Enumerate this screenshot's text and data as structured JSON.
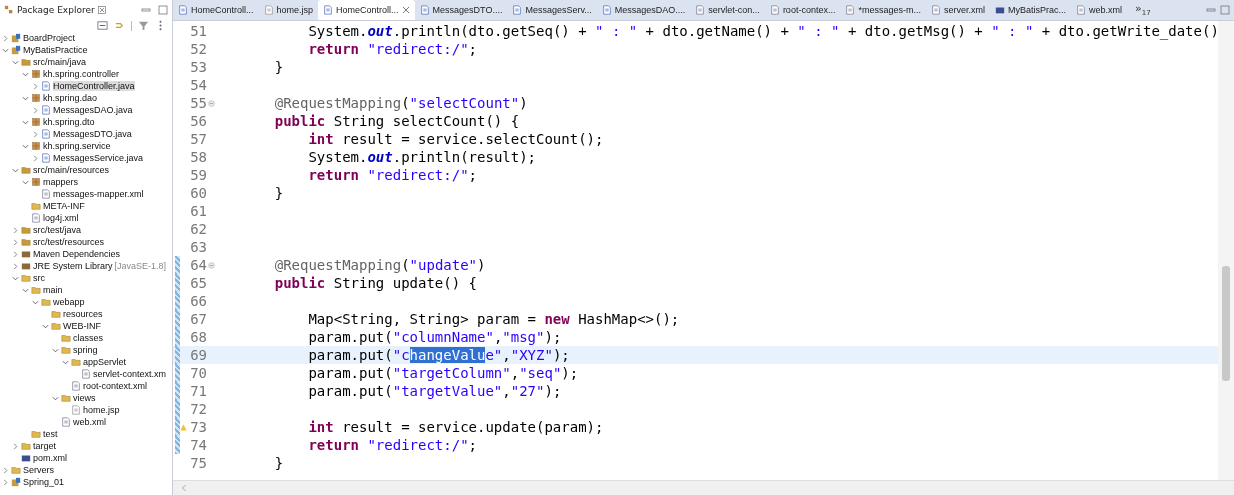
{
  "explorer": {
    "title": "Package Explorer",
    "tree": [
      {
        "label": "BoardProject",
        "kind": "project",
        "expanded": false
      },
      {
        "label": "MyBatisPractice",
        "kind": "project",
        "expanded": true,
        "children": [
          {
            "label": "src/main/java",
            "kind": "srcfolder",
            "expanded": true,
            "children": [
              {
                "label": "kh.spring.controller",
                "kind": "package",
                "expanded": true,
                "children": [
                  {
                    "label": "HomeController.java",
                    "kind": "java",
                    "expanded": false,
                    "selected": true
                  }
                ]
              },
              {
                "label": "kh.spring.dao",
                "kind": "package",
                "expanded": true,
                "children": [
                  {
                    "label": "MessagesDAO.java",
                    "kind": "java",
                    "expanded": false,
                    "selected": false
                  }
                ]
              },
              {
                "label": "kh.spring.dto",
                "kind": "package",
                "expanded": true,
                "children": [
                  {
                    "label": "MessagesDTO.java",
                    "kind": "java",
                    "expanded": false,
                    "selected": false
                  }
                ]
              },
              {
                "label": "kh.spring.service",
                "kind": "package",
                "expanded": true,
                "children": [
                  {
                    "label": "MessagesService.java",
                    "kind": "java",
                    "expanded": false,
                    "selected": false
                  }
                ]
              }
            ]
          },
          {
            "label": "src/main/resources",
            "kind": "srcfolder",
            "expanded": true,
            "children": [
              {
                "label": "mappers",
                "kind": "package",
                "expanded": true,
                "children": [
                  {
                    "label": "messages-mapper.xml",
                    "kind": "xml"
                  }
                ]
              },
              {
                "label": "META-INF",
                "kind": "folder"
              },
              {
                "label": "log4j.xml",
                "kind": "xml"
              }
            ]
          },
          {
            "label": "src/test/java",
            "kind": "srcfolder",
            "expanded": false
          },
          {
            "label": "src/test/resources",
            "kind": "srcfolder",
            "expanded": false
          },
          {
            "label": "Maven Dependencies",
            "kind": "library",
            "expanded": false
          },
          {
            "label": "JRE System Library",
            "suffix": "[JavaSE-1.8]",
            "kind": "library",
            "expanded": false
          },
          {
            "label": "src",
            "kind": "folder",
            "expanded": true,
            "children": [
              {
                "label": "main",
                "kind": "folder",
                "expanded": true,
                "children": [
                  {
                    "label": "webapp",
                    "kind": "folder",
                    "expanded": true,
                    "children": [
                      {
                        "label": "resources",
                        "kind": "folder"
                      },
                      {
                        "label": "WEB-INF",
                        "kind": "folder",
                        "expanded": true,
                        "children": [
                          {
                            "label": "classes",
                            "kind": "folder"
                          },
                          {
                            "label": "spring",
                            "kind": "folder",
                            "expanded": true,
                            "children": [
                              {
                                "label": "appServlet",
                                "kind": "folder",
                                "expanded": true,
                                "children": [
                                  {
                                    "label": "servlet-context.xm",
                                    "kind": "xml"
                                  }
                                ]
                              },
                              {
                                "label": "root-context.xml",
                                "kind": "xml"
                              }
                            ]
                          },
                          {
                            "label": "views",
                            "kind": "folder",
                            "expanded": true,
                            "children": [
                              {
                                "label": "home.jsp",
                                "kind": "jsp"
                              }
                            ]
                          },
                          {
                            "label": "web.xml",
                            "kind": "xml"
                          }
                        ]
                      }
                    ]
                  }
                ]
              },
              {
                "label": "test",
                "kind": "folder"
              }
            ]
          },
          {
            "label": "target",
            "kind": "folder",
            "expanded": false
          },
          {
            "label": "pom.xml",
            "kind": "maven"
          }
        ]
      },
      {
        "label": "Servers",
        "kind": "folder",
        "expanded": false
      },
      {
        "label": "Spring_01",
        "kind": "project",
        "expanded": false
      }
    ]
  },
  "tabs": [
    {
      "label": "HomeControll...",
      "kind": "java",
      "selected": false
    },
    {
      "label": "home.jsp",
      "kind": "jsp",
      "selected": false
    },
    {
      "label": "HomeControll...",
      "kind": "java",
      "selected": true
    },
    {
      "label": "MessagesDTO....",
      "kind": "java",
      "selected": false
    },
    {
      "label": "MessagesServ...",
      "kind": "java",
      "selected": false
    },
    {
      "label": "MessagesDAO....",
      "kind": "java",
      "selected": false
    },
    {
      "label": "servlet-con...",
      "kind": "xml",
      "selected": false
    },
    {
      "label": "root-contex...",
      "kind": "xml",
      "selected": false
    },
    {
      "label": "*messages-m...",
      "kind": "xml",
      "selected": false
    },
    {
      "label": "server.xml",
      "kind": "xml",
      "selected": false
    },
    {
      "label": "MyBatisPrac...",
      "kind": "maven",
      "selected": false
    },
    {
      "label": "web.xml",
      "kind": "xml",
      "selected": false
    }
  ],
  "overflow_tabs": {
    "symbol": "»",
    "count": "17"
  },
  "editor": {
    "lines": [
      {
        "number": "51",
        "current": false,
        "segments": [
          {
            "kind": "code",
            "text": "        System."
          },
          {
            "kind": "field",
            "text": "out"
          },
          {
            "kind": "code",
            "text": ".println(dto.getSeq() + "
          },
          {
            "kind": "string",
            "text": "\" : \""
          },
          {
            "kind": "code",
            "text": " + dto.getName() + "
          },
          {
            "kind": "string",
            "text": "\" : \""
          },
          {
            "kind": "code",
            "text": " + dto.getMsg() + "
          },
          {
            "kind": "string",
            "text": "\" : \""
          },
          {
            "kind": "code",
            "text": " + dto.getWrite_date()"
          }
        ]
      },
      {
        "number": "52",
        "current": false,
        "segments": [
          {
            "kind": "keyword",
            "text": "        return "
          },
          {
            "kind": "string",
            "text": "\"redirect:/\""
          },
          {
            "kind": "code",
            "text": ";"
          }
        ]
      },
      {
        "number": "53",
        "current": false,
        "segments": [
          {
            "kind": "code",
            "text": "    }"
          }
        ]
      },
      {
        "number": "54",
        "current": false
      },
      {
        "number": "55",
        "current": false,
        "fold": true,
        "segments": [
          {
            "kind": "annotation",
            "text": "    @RequestMapping"
          },
          {
            "kind": "code",
            "text": "("
          },
          {
            "kind": "string",
            "text": "\"selectCount\""
          },
          {
            "kind": "code",
            "text": ")"
          }
        ]
      },
      {
        "number": "56",
        "current": false,
        "segments": [
          {
            "kind": "keyword",
            "text": "    public "
          },
          {
            "kind": "code",
            "text": "String selectCount() {"
          }
        ]
      },
      {
        "number": "57",
        "current": false,
        "segments": [
          {
            "kind": "keyword",
            "text": "        int "
          },
          {
            "kind": "code",
            "text": "result = service.selectCount();"
          }
        ]
      },
      {
        "number": "58",
        "current": false,
        "segments": [
          {
            "kind": "code",
            "text": "        System."
          },
          {
            "kind": "field",
            "text": "out"
          },
          {
            "kind": "code",
            "text": ".println(result);"
          }
        ]
      },
      {
        "number": "59",
        "current": false,
        "segments": [
          {
            "kind": "keyword",
            "text": "        return "
          },
          {
            "kind": "string",
            "text": "\"redirect:/\""
          },
          {
            "kind": "code",
            "text": ";"
          }
        ]
      },
      {
        "number": "60",
        "current": false,
        "segments": [
          {
            "kind": "code",
            "text": "    }"
          }
        ]
      },
      {
        "number": "61",
        "current": false
      },
      {
        "number": "62",
        "current": false
      },
      {
        "number": "63",
        "current": false
      },
      {
        "number": "64",
        "current": false,
        "fold": true,
        "changed": true,
        "segments": [
          {
            "kind": "annotation",
            "text": "    @RequestMapping"
          },
          {
            "kind": "code",
            "text": "("
          },
          {
            "kind": "string",
            "text": "\"update\""
          },
          {
            "kind": "code",
            "text": ")"
          }
        ]
      },
      {
        "number": "65",
        "current": false,
        "changed": true,
        "segments": [
          {
            "kind": "keyword",
            "text": "    public "
          },
          {
            "kind": "code",
            "text": "String update() {"
          }
        ]
      },
      {
        "number": "66",
        "current": false,
        "changed": true
      },
      {
        "number": "67",
        "current": false,
        "changed": true,
        "segments": [
          {
            "kind": "code",
            "text": "        Map<String, String> param = "
          },
          {
            "kind": "keyword",
            "text": "new "
          },
          {
            "kind": "code",
            "text": "HashMap<>();"
          }
        ]
      },
      {
        "number": "68",
        "current": false,
        "changed": true,
        "segments": [
          {
            "kind": "code",
            "text": "        param.put("
          },
          {
            "kind": "string",
            "text": "\"columnName\""
          },
          {
            "kind": "code",
            "text": ","
          },
          {
            "kind": "string",
            "text": "\"msg\""
          },
          {
            "kind": "code",
            "text": ");"
          }
        ]
      },
      {
        "number": "69",
        "current": true,
        "changed": true,
        "segments": [
          {
            "kind": "code",
            "text": "        param.put("
          },
          {
            "kind": "string",
            "text": "\"c"
          },
          {
            "kind": "selection",
            "text": "hangeValu"
          },
          {
            "kind": "string",
            "text": "e\""
          },
          {
            "kind": "code",
            "text": ","
          },
          {
            "kind": "string",
            "text": "\"XYZ\""
          },
          {
            "kind": "code",
            "text": ");"
          }
        ]
      },
      {
        "number": "70",
        "current": false,
        "changed": true,
        "segments": [
          {
            "kind": "code",
            "text": "        param.put("
          },
          {
            "kind": "string",
            "text": "\"targetColumn\""
          },
          {
            "kind": "code",
            "text": ","
          },
          {
            "kind": "string",
            "text": "\"seq\""
          },
          {
            "kind": "code",
            "text": ");"
          }
        ]
      },
      {
        "number": "71",
        "current": false,
        "changed": true,
        "segments": [
          {
            "kind": "code",
            "text": "        param.put("
          },
          {
            "kind": "string",
            "text": "\"targetValue\""
          },
          {
            "kind": "code",
            "text": ","
          },
          {
            "kind": "string",
            "text": "\"27\""
          },
          {
            "kind": "code",
            "text": ");"
          }
        ]
      },
      {
        "number": "72",
        "current": false,
        "changed": true
      },
      {
        "number": "73",
        "current": false,
        "changed": true,
        "warning": true,
        "segments": [
          {
            "kind": "keyword",
            "text": "        int "
          },
          {
            "kind": "code",
            "text": "result = service.update(param);"
          }
        ]
      },
      {
        "number": "74",
        "current": false,
        "changed": true,
        "segments": [
          {
            "kind": "keyword",
            "text": "        return "
          },
          {
            "kind": "string",
            "text": "\"redirect:/\""
          },
          {
            "kind": "code",
            "text": ";"
          }
        ]
      },
      {
        "number": "75",
        "current": false,
        "segments": [
          {
            "kind": "code",
            "text": "    }"
          }
        ]
      }
    ]
  }
}
